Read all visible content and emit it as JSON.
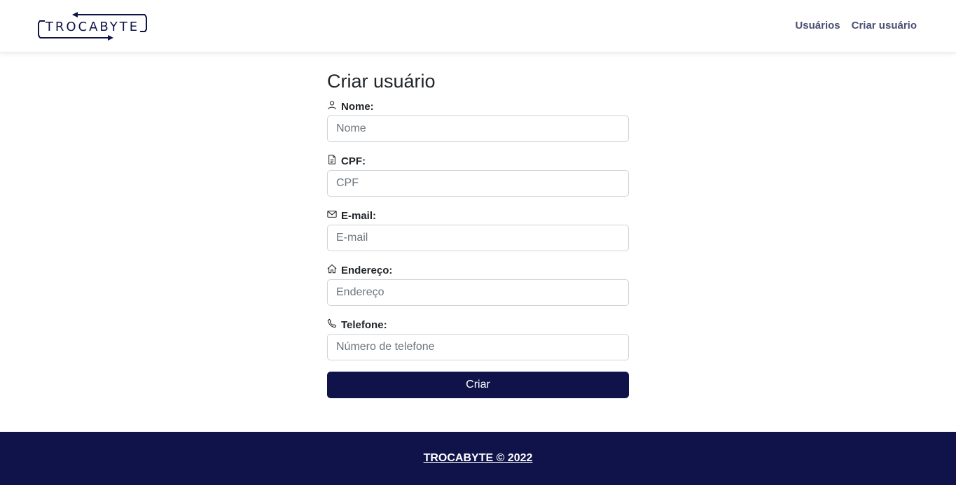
{
  "brand": {
    "logo_text": "TROCABYTE",
    "color": "#10134a"
  },
  "nav": {
    "items": [
      {
        "label": "Usuários"
      },
      {
        "label": "Criar usuário"
      }
    ]
  },
  "form": {
    "title": "Criar usuário",
    "fields": [
      {
        "label": "Nome:",
        "placeholder": "Nome",
        "value": "",
        "icon": "person-icon"
      },
      {
        "label": "CPF:",
        "placeholder": "CPF",
        "value": "",
        "icon": "document-icon"
      },
      {
        "label": "E-mail:",
        "placeholder": "E-mail",
        "value": "",
        "icon": "envelope-icon"
      },
      {
        "label": "Endereço:",
        "placeholder": "Endereço",
        "value": "",
        "icon": "house-icon"
      },
      {
        "label": "Telefone:",
        "placeholder": "Número de telefone",
        "value": "",
        "icon": "phone-icon"
      }
    ],
    "submit_label": "Criar"
  },
  "footer": {
    "text": "TROCABYTE © 2022"
  }
}
